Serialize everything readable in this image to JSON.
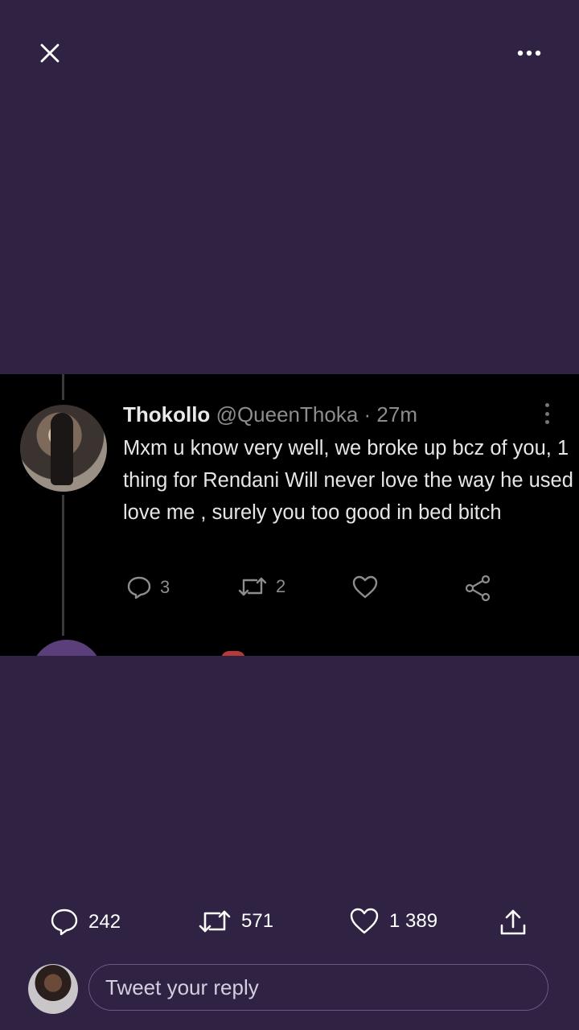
{
  "media_tweet": {
    "name": "Thokollo",
    "handle": "@QueenThoka",
    "time": "· 27m",
    "body": "Mxm u know very well, we broke up  bcz of you, 1 thing for Rendani Will never love the way he used love me , surely you too good in bed bitch",
    "reply_count": "3",
    "retweet_count": "2"
  },
  "actions": {
    "reply_count": "242",
    "retweet_count": "571",
    "like_count": "1 389"
  },
  "composer": {
    "placeholder": "Tweet your reply"
  },
  "colors": {
    "background": "#2f2243",
    "icon": "#ffffff"
  }
}
